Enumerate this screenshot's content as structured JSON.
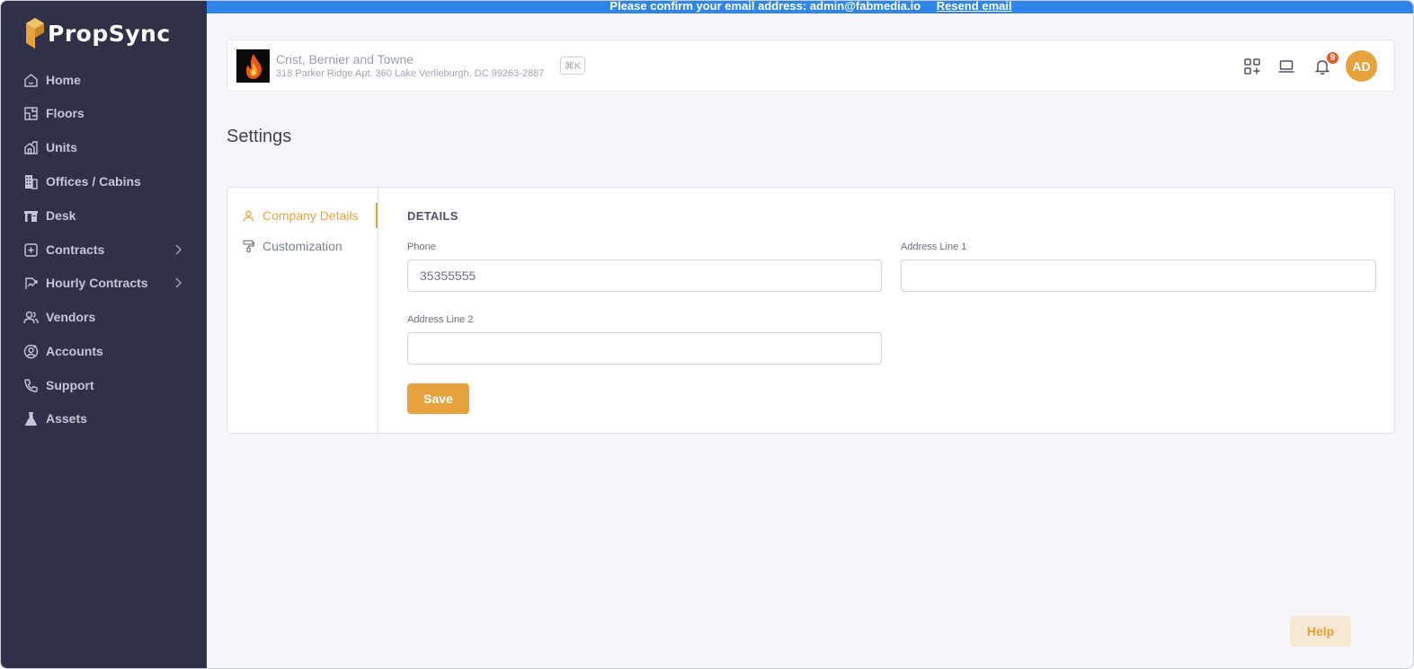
{
  "app": {
    "name": "PropSync"
  },
  "banner": {
    "message": "Please confirm your email address: admin@fabmedia.io",
    "link": "Resend email"
  },
  "sidebar": {
    "items": [
      {
        "label": "Home",
        "icon": "home-icon",
        "has_submenu": false
      },
      {
        "label": "Floors",
        "icon": "floorplan-icon",
        "has_submenu": false
      },
      {
        "label": "Units",
        "icon": "units-icon",
        "has_submenu": false
      },
      {
        "label": "Offices / Cabins",
        "icon": "building-icon",
        "has_submenu": false
      },
      {
        "label": "Desk",
        "icon": "desk-icon",
        "has_submenu": false
      },
      {
        "label": "Contracts",
        "icon": "contract-icon",
        "has_submenu": true
      },
      {
        "label": "Hourly Contracts",
        "icon": "hourly-contract-icon",
        "has_submenu": true
      },
      {
        "label": "Vendors",
        "icon": "users-icon",
        "has_submenu": false
      },
      {
        "label": "Accounts",
        "icon": "account-icon",
        "has_submenu": false
      },
      {
        "label": "Support",
        "icon": "phone-icon",
        "has_submenu": false
      },
      {
        "label": "Assets",
        "icon": "flask-icon",
        "has_submenu": false
      }
    ]
  },
  "header": {
    "company_name": "Crist, Bernier and Towne",
    "company_address": "318 Parker Ridge Apt. 360 Lake Verlieburgh, DC 99263-2887",
    "shortcut": "⌘K",
    "notification_count": "9",
    "avatar_initials": "AD"
  },
  "page": {
    "title": "Settings"
  },
  "settings": {
    "tabs": [
      {
        "label": "Company Details",
        "active": true
      },
      {
        "label": "Customization",
        "active": false
      }
    ],
    "section_title": "DETAILS",
    "fields": {
      "phone": {
        "label": "Phone",
        "value": "35355555"
      },
      "address1": {
        "label": "Address Line 1",
        "value": ""
      },
      "address2": {
        "label": "Address Line 2",
        "value": ""
      }
    },
    "save_label": "Save"
  },
  "help_label": "Help",
  "colors": {
    "accent": "#e6a23c",
    "sidebar": "#2e3148",
    "banner": "#2f86e8",
    "badge": "#e0602a"
  }
}
